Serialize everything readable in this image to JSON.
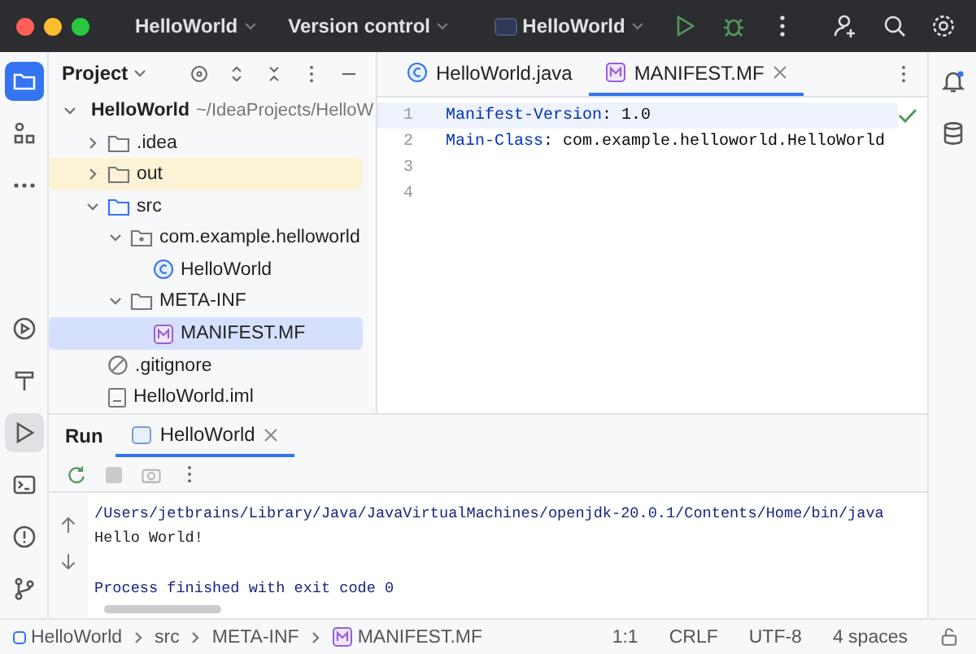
{
  "title_bar": {
    "project": "HelloWorld",
    "vcs": "Version control",
    "run_config": "HelloWorld"
  },
  "project_panel": {
    "title": "Project",
    "tree": [
      {
        "label": "HelloWorld",
        "kind": "module",
        "path": "~/IdeaProjects/HelloW",
        "expanded": true,
        "selected": false,
        "highlighted": false,
        "children": [
          {
            "label": ".idea",
            "kind": "folder",
            "expanded": false,
            "selected": false,
            "highlighted": false
          },
          {
            "label": "out",
            "kind": "folder",
            "expanded": false,
            "selected": false,
            "highlighted": true
          },
          {
            "label": "src",
            "kind": "source",
            "expanded": true,
            "selected": false,
            "highlighted": false,
            "children": [
              {
                "label": "com.example.helloworld",
                "kind": "package",
                "expanded": true,
                "selected": false,
                "highlighted": false,
                "children": [
                  {
                    "label": "HelloWorld",
                    "kind": "class",
                    "selected": false,
                    "highlighted": false
                  }
                ]
              },
              {
                "label": "META-INF",
                "kind": "folder",
                "expanded": true,
                "selected": false,
                "highlighted": false,
                "children": [
                  {
                    "label": "MANIFEST.MF",
                    "kind": "manifest",
                    "selected": true,
                    "highlighted": false
                  }
                ]
              }
            ]
          },
          {
            "label": ".gitignore",
            "kind": "ignore",
            "selected": false,
            "highlighted": false
          },
          {
            "label": "HelloWorld.iml",
            "kind": "iml",
            "selected": false,
            "highlighted": false
          }
        ]
      }
    ]
  },
  "editor": {
    "tabs": [
      {
        "label": "HelloWorld.java",
        "kind": "class",
        "selected": false,
        "closable": false
      },
      {
        "label": "MANIFEST.MF",
        "kind": "manifest",
        "selected": true,
        "closable": true
      }
    ],
    "lines": [
      {
        "number": "1",
        "current": true,
        "tokens": [
          {
            "text": "Manifest-Version",
            "kind": "key"
          },
          {
            "text": ": 1.0",
            "kind": "plain"
          }
        ]
      },
      {
        "number": "2",
        "current": false,
        "tokens": [
          {
            "text": "Main-Class",
            "kind": "key"
          },
          {
            "text": ": com.example.helloworld.HelloWorld",
            "kind": "plain"
          }
        ]
      },
      {
        "number": "3",
        "current": false
      },
      {
        "number": "4",
        "current": false
      }
    ]
  },
  "run_panel": {
    "title": "Run",
    "tabs": [
      {
        "label": "HelloWorld",
        "selected": true
      }
    ],
    "console": [
      {
        "text": "/Users/jetbrains/Library/Java/JavaVirtualMachines/openjdk-20.0.1/Contents/Home/bin/java",
        "kind": "command"
      },
      {
        "text": "Hello World!",
        "kind": "output"
      },
      {
        "text": "Process finished with exit code 0",
        "kind": "system"
      }
    ]
  },
  "status_bar": {
    "breadcrumbs": [
      {
        "label": "HelloWorld",
        "kind": "module"
      },
      {
        "label": "src",
        "kind": "plain"
      },
      {
        "label": "META-INF",
        "kind": "plain"
      },
      {
        "label": "MANIFEST.MF",
        "kind": "manifest"
      }
    ],
    "items": [
      "1:1",
      "CRLF",
      "UTF-8",
      "4 spaces"
    ]
  }
}
